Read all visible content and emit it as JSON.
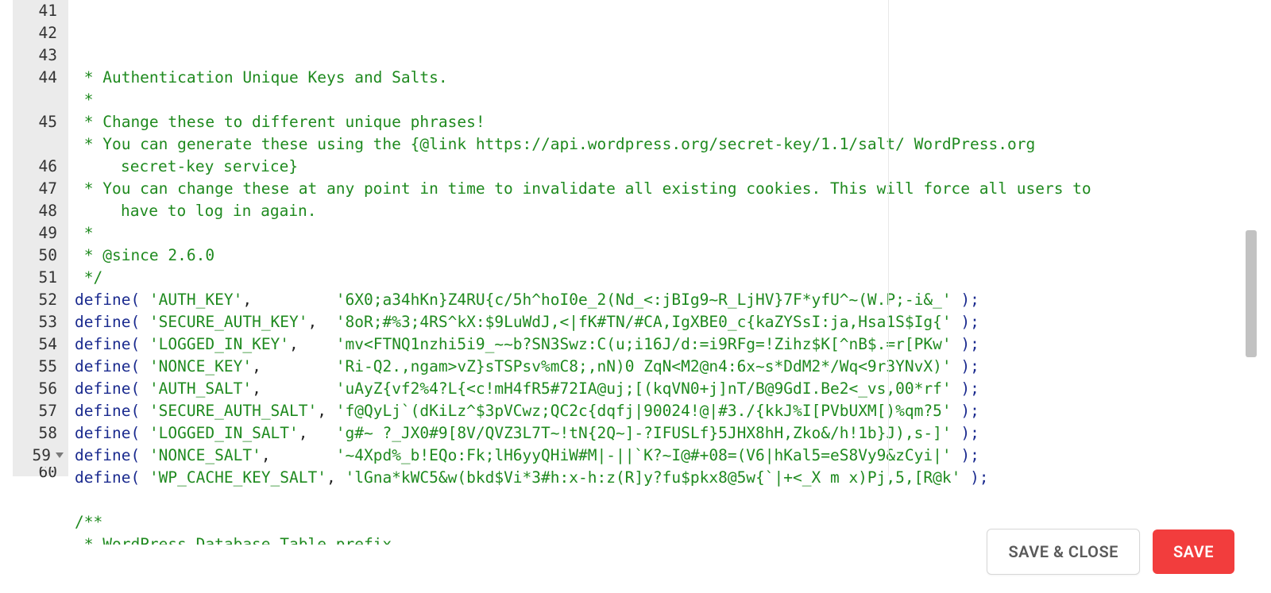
{
  "editor": {
    "first_line_number": 41,
    "print_margin_col": 80,
    "rows": [
      {
        "n": 41,
        "segs": [
          {
            "cls": "c-comment",
            "t": " * Authentication Unique Keys and Salts."
          }
        ]
      },
      {
        "n": 42,
        "segs": [
          {
            "cls": "c-comment",
            "t": " *"
          }
        ]
      },
      {
        "n": 43,
        "segs": [
          {
            "cls": "c-comment",
            "t": " * Change these to different unique phrases!"
          }
        ]
      },
      {
        "n": 44,
        "segs": [
          {
            "cls": "c-comment",
            "t": " * You can generate these using the {@link https://api.wordpress.org/secret-key/1.1/salt/ WordPress.org "
          }
        ]
      },
      {
        "n": null,
        "cont": true,
        "segs": [
          {
            "cls": "c-comment",
            "t": "secret-key service}"
          }
        ]
      },
      {
        "n": 45,
        "segs": [
          {
            "cls": "c-comment",
            "t": " * You can change these at any point in time to invalidate all existing cookies. This will force all users to "
          }
        ]
      },
      {
        "n": null,
        "cont": true,
        "segs": [
          {
            "cls": "c-comment",
            "t": "have to log in again."
          }
        ]
      },
      {
        "n": 46,
        "segs": [
          {
            "cls": "c-comment",
            "t": " *"
          }
        ]
      },
      {
        "n": 47,
        "segs": [
          {
            "cls": "c-comment",
            "t": " * @since 2.6.0"
          }
        ]
      },
      {
        "n": 48,
        "segs": [
          {
            "cls": "c-comment",
            "t": " */"
          }
        ]
      },
      {
        "n": 49,
        "segs": [
          {
            "cls": "c-ident",
            "t": "define"
          },
          {
            "cls": "c-paren",
            "t": "( "
          },
          {
            "cls": "c-string",
            "t": "'AUTH_KEY'"
          },
          {
            "cls": "c-plain",
            "t": ",         "
          },
          {
            "cls": "c-string",
            "t": "'6X0;a34hKn}Z4RU{c/5h^hoI0e_2(Nd_<:jBIg9~R_LjHV}7F*yfU^~(W.P;-i&_'"
          },
          {
            "cls": "c-paren",
            "t": " );"
          }
        ]
      },
      {
        "n": 50,
        "segs": [
          {
            "cls": "c-ident",
            "t": "define"
          },
          {
            "cls": "c-paren",
            "t": "( "
          },
          {
            "cls": "c-string",
            "t": "'SECURE_AUTH_KEY'"
          },
          {
            "cls": "c-plain",
            "t": ",  "
          },
          {
            "cls": "c-string",
            "t": "'8oR;#%3;4RS^kX:$9LuWdJ,<|fK#TN/#CA,IgXBE0_c{kaZYSsI:ja,Hsa1S$Ig{'"
          },
          {
            "cls": "c-paren",
            "t": " );"
          }
        ]
      },
      {
        "n": 51,
        "segs": [
          {
            "cls": "c-ident",
            "t": "define"
          },
          {
            "cls": "c-paren",
            "t": "( "
          },
          {
            "cls": "c-string",
            "t": "'LOGGED_IN_KEY'"
          },
          {
            "cls": "c-plain",
            "t": ",    "
          },
          {
            "cls": "c-string",
            "t": "'mv<FTNQ1nzhi5i9_~~b?SN3Swz:C(u;i16J/d:=i9RFg=!Zihz$K[^nB$.=r[PKw'"
          },
          {
            "cls": "c-paren",
            "t": " );"
          }
        ]
      },
      {
        "n": 52,
        "segs": [
          {
            "cls": "c-ident",
            "t": "define"
          },
          {
            "cls": "c-paren",
            "t": "( "
          },
          {
            "cls": "c-string",
            "t": "'NONCE_KEY'"
          },
          {
            "cls": "c-plain",
            "t": ",        "
          },
          {
            "cls": "c-string",
            "t": "'Ri-Q2.,ngam>vZ}sTSPsv%mC8;,nN)0 ZqN<M2@n4:6x~s*DdM2*/Wq<9r3YNvX)'"
          },
          {
            "cls": "c-paren",
            "t": " );"
          }
        ]
      },
      {
        "n": 53,
        "segs": [
          {
            "cls": "c-ident",
            "t": "define"
          },
          {
            "cls": "c-paren",
            "t": "( "
          },
          {
            "cls": "c-string",
            "t": "'AUTH_SALT'"
          },
          {
            "cls": "c-plain",
            "t": ",        "
          },
          {
            "cls": "c-string",
            "t": "'uAyZ{vf2%4?L{<c!mH4fR5#72IA@uj;[(kqVN0+j]nT/B@9GdI.Be2<_vs,00*rf'"
          },
          {
            "cls": "c-paren",
            "t": " );"
          }
        ]
      },
      {
        "n": 54,
        "segs": [
          {
            "cls": "c-ident",
            "t": "define"
          },
          {
            "cls": "c-paren",
            "t": "( "
          },
          {
            "cls": "c-string",
            "t": "'SECURE_AUTH_SALT'"
          },
          {
            "cls": "c-plain",
            "t": ", "
          },
          {
            "cls": "c-string",
            "t": "'f@QyLj`(dKiLz^$3pVCwz;QC2c{dqfj|90024!@|#3./{kkJ%I[PVbUXM[)%qm?5'"
          },
          {
            "cls": "c-paren",
            "t": " );"
          }
        ]
      },
      {
        "n": 55,
        "segs": [
          {
            "cls": "c-ident",
            "t": "define"
          },
          {
            "cls": "c-paren",
            "t": "( "
          },
          {
            "cls": "c-string",
            "t": "'LOGGED_IN_SALT'"
          },
          {
            "cls": "c-plain",
            "t": ",   "
          },
          {
            "cls": "c-string",
            "t": "'g#~ ?_JX0#9[8V/QVZ3L7T~!tN{2Q~]-?IFUSLf}5JHX8hH,Zko&/h!1b}J),s-]'"
          },
          {
            "cls": "c-paren",
            "t": " );"
          }
        ]
      },
      {
        "n": 56,
        "segs": [
          {
            "cls": "c-ident",
            "t": "define"
          },
          {
            "cls": "c-paren",
            "t": "( "
          },
          {
            "cls": "c-string",
            "t": "'NONCE_SALT'"
          },
          {
            "cls": "c-plain",
            "t": ",       "
          },
          {
            "cls": "c-string",
            "t": "'~4Xpd%_b!EQo:Fk;lH6yyQHiW#M|-||`K?~I@#+08=(V6|hKal5=eS8Vy9&zCyi|'"
          },
          {
            "cls": "c-paren",
            "t": " );"
          }
        ]
      },
      {
        "n": 57,
        "segs": [
          {
            "cls": "c-ident",
            "t": "define"
          },
          {
            "cls": "c-paren",
            "t": "( "
          },
          {
            "cls": "c-string",
            "t": "'WP_CACHE_KEY_SALT'"
          },
          {
            "cls": "c-plain",
            "t": ", "
          },
          {
            "cls": "c-string",
            "t": "'lGna*kWC5&w(bkd$Vi*3#h:x-h:z(R]y?fu$pkx8@5w{`|+<_X m x)Pj,5,[R@k'"
          },
          {
            "cls": "c-paren",
            "t": " );"
          }
        ]
      },
      {
        "n": 58,
        "segs": [
          {
            "cls": "c-plain",
            "t": ""
          }
        ]
      },
      {
        "n": 59,
        "fold": true,
        "segs": [
          {
            "cls": "c-comment",
            "t": "/**"
          }
        ]
      },
      {
        "n": 60,
        "partial": true,
        "segs": [
          {
            "cls": "c-comment",
            "t": " * WordPress Database Table prefix."
          }
        ]
      }
    ]
  },
  "footer": {
    "save_close_label": "SAVE & CLOSE",
    "save_label": "SAVE"
  }
}
